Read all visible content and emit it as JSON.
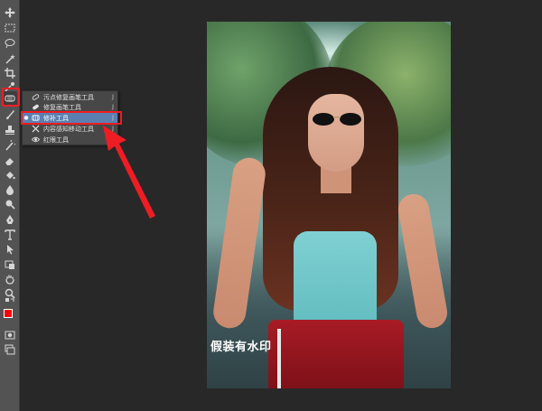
{
  "tool_flyout": {
    "items": [
      {
        "label": "污点修复画笔工具",
        "shortcut": "J",
        "icon": "spot-healing-brush-icon",
        "selected": false
      },
      {
        "label": "修复画笔工具",
        "shortcut": "J",
        "icon": "healing-brush-icon",
        "selected": false
      },
      {
        "label": "修补工具",
        "shortcut": "J",
        "icon": "patch-icon",
        "selected": true
      },
      {
        "label": "内容感知移动工具",
        "shortcut": "J",
        "icon": "content-aware-move-icon",
        "selected": false
      },
      {
        "label": "红眼工具",
        "shortcut": "J",
        "icon": "red-eye-icon",
        "selected": false
      }
    ]
  },
  "canvas": {
    "watermark_text": "假装有水印"
  },
  "colors": {
    "foreground": "#ff0000",
    "background": "#ffffff",
    "highlight": "#ee1d24",
    "menu_selection": "#5a7fb0"
  },
  "toolbar": {
    "tools": [
      "move-icon",
      "marquee-icon",
      "lasso-icon",
      "magic-wand-icon",
      "crop-icon",
      "eyedropper-icon",
      "healing-icon",
      "brush-icon",
      "stamp-icon",
      "history-brush-icon",
      "eraser-icon",
      "paint-bucket-icon",
      "blur-icon",
      "dodge-icon",
      "pen-icon",
      "type-icon",
      "path-select-icon",
      "shape-icon",
      "hand-icon",
      "zoom-icon"
    ]
  }
}
